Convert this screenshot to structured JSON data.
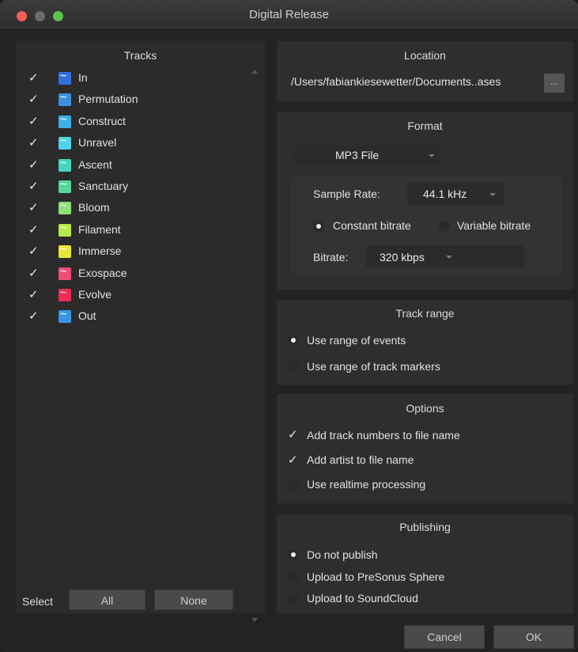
{
  "window": {
    "title": "Digital Release"
  },
  "tracks": {
    "title": "Tracks",
    "items": [
      {
        "name": "In",
        "checked": true,
        "color": "#2f6fe0"
      },
      {
        "name": "Permutation",
        "checked": true,
        "color": "#3d8fe0"
      },
      {
        "name": "Construct",
        "checked": true,
        "color": "#3fb2e6"
      },
      {
        "name": "Unravel",
        "checked": true,
        "color": "#4fd4e8"
      },
      {
        "name": "Ascent",
        "checked": true,
        "color": "#46d6c0"
      },
      {
        "name": "Sanctuary",
        "checked": true,
        "color": "#56d79a"
      },
      {
        "name": "Bloom",
        "checked": true,
        "color": "#8fe07a"
      },
      {
        "name": "Filament",
        "checked": true,
        "color": "#b8e84a"
      },
      {
        "name": "Immerse",
        "checked": true,
        "color": "#e8e83a"
      },
      {
        "name": "Exospace",
        "checked": true,
        "color": "#ee4e78"
      },
      {
        "name": "Evolve",
        "checked": true,
        "color": "#ef2b55"
      },
      {
        "name": "Out",
        "checked": true,
        "color": "#3a95e8"
      }
    ],
    "select_label": "Select",
    "all_button": "All",
    "none_button": "None"
  },
  "location": {
    "title": "Location",
    "path": "/Users/fabiankiesewetter/Documents..ases",
    "browse_label": "..."
  },
  "format": {
    "title": "Format",
    "file_type": "MP3 File",
    "sample_rate_label": "Sample Rate:",
    "sample_rate": "44.1 kHz",
    "constant_bitrate": "Constant bitrate",
    "variable_bitrate": "Variable bitrate",
    "bitrate_label": "Bitrate:",
    "bitrate": "320 kbps"
  },
  "track_range": {
    "title": "Track range",
    "option_events": "Use range of events",
    "option_markers": "Use range of track markers"
  },
  "options": {
    "title": "Options",
    "add_track_numbers": "Add track numbers to file name",
    "add_artist": "Add artist to file name",
    "realtime": "Use realtime processing"
  },
  "publishing": {
    "title": "Publishing",
    "do_not_publish": "Do not publish",
    "upload_sphere": "Upload to PreSonus Sphere",
    "upload_soundcloud": "Upload to SoundCloud"
  },
  "footer": {
    "cancel": "Cancel",
    "ok": "OK"
  }
}
